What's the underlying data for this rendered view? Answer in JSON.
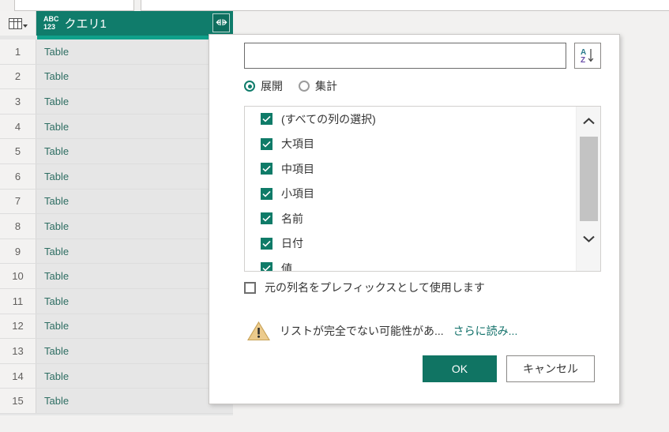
{
  "grid": {
    "row_header_icon": "table-grid-icon",
    "column": {
      "type_badge_line1": "ABC",
      "type_badge_line2": "123",
      "title": "クエリ1",
      "expand_icon": "expand-columns-icon"
    },
    "rows": [
      {
        "num": "1",
        "value": "Table"
      },
      {
        "num": "2",
        "value": "Table"
      },
      {
        "num": "3",
        "value": "Table"
      },
      {
        "num": "4",
        "value": "Table"
      },
      {
        "num": "5",
        "value": "Table"
      },
      {
        "num": "6",
        "value": "Table"
      },
      {
        "num": "7",
        "value": "Table"
      },
      {
        "num": "8",
        "value": "Table"
      },
      {
        "num": "9",
        "value": "Table"
      },
      {
        "num": "10",
        "value": "Table"
      },
      {
        "num": "11",
        "value": "Table"
      },
      {
        "num": "12",
        "value": "Table"
      },
      {
        "num": "13",
        "value": "Table"
      },
      {
        "num": "14",
        "value": "Table"
      },
      {
        "num": "15",
        "value": "Table"
      }
    ]
  },
  "dialog": {
    "search": {
      "value": "",
      "placeholder": ""
    },
    "sort_button_icon": "sort-a-to-z-icon",
    "radios": [
      {
        "label": "展開",
        "selected": true
      },
      {
        "label": "集計",
        "selected": false
      }
    ],
    "columns": [
      {
        "label": "(すべての列の選択)",
        "checked": true
      },
      {
        "label": "大項目",
        "checked": true
      },
      {
        "label": "中項目",
        "checked": true
      },
      {
        "label": "小項目",
        "checked": true
      },
      {
        "label": "名前",
        "checked": true
      },
      {
        "label": "日付",
        "checked": true
      },
      {
        "label": "値",
        "checked": true
      }
    ],
    "scrollbar": {
      "up_icon": "chevron-up-icon",
      "down_icon": "chevron-down-icon"
    },
    "prefix_checkbox": {
      "label": "元の列名をプレフィックスとして使用します",
      "checked": false
    },
    "warning": {
      "icon": "warning-triangle-icon",
      "text": "リストが完全でない可能性があ...",
      "link": "さらに読み..."
    },
    "buttons": {
      "ok": "OK",
      "cancel": "キャンセル"
    }
  },
  "colors": {
    "accent_green": "#107c6b",
    "accent_light": "#0fa08a",
    "link_teal": "#14726b",
    "warning_tan": "#e8c27a"
  }
}
